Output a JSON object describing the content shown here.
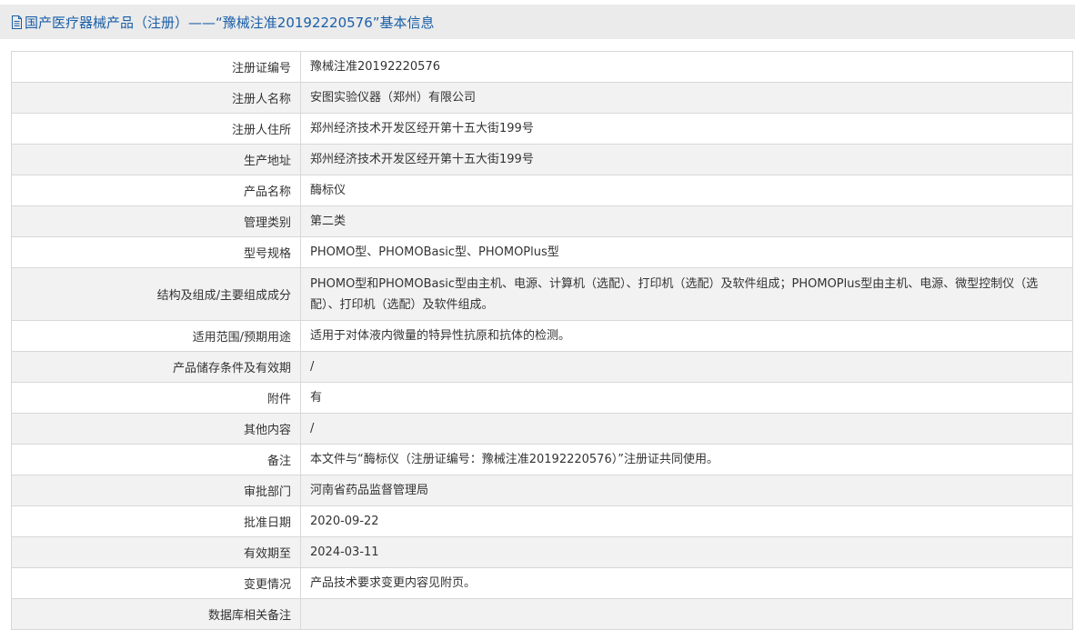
{
  "header": {
    "icon": "document-icon",
    "title": "国产医疗器械产品（注册）——“豫械注准20192220576”基本信息",
    "title_color": "#1a5fa8"
  },
  "rows": [
    {
      "label": "注册证编号",
      "value": "豫械注准20192220576"
    },
    {
      "label": "注册人名称",
      "value": "安图实验仪器（郑州）有限公司"
    },
    {
      "label": "注册人住所",
      "value": "郑州经济技术开发区经开第十五大街199号"
    },
    {
      "label": "生产地址",
      "value": "郑州经济技术开发区经开第十五大街199号"
    },
    {
      "label": "产品名称",
      "value": "酶标仪"
    },
    {
      "label": "管理类别",
      "value": "第二类"
    },
    {
      "label": "型号规格",
      "value": "PHOMO型、PHOMOBasic型、PHOMOPlus型"
    },
    {
      "label": "结构及组成/主要组成成分",
      "value": "PHOMO型和PHOMOBasic型由主机、电源、计算机（选配）、打印机（选配）及软件组成；PHOMOPlus型由主机、电源、微型控制仪（选配）、打印机（选配）及软件组成。"
    },
    {
      "label": "适用范围/预期用途",
      "value": "适用于对体液内微量的特异性抗原和抗体的检测。"
    },
    {
      "label": "产品储存条件及有效期",
      "value": "/"
    },
    {
      "label": "附件",
      "value": "有"
    },
    {
      "label": "其他内容",
      "value": "/"
    },
    {
      "label": "备注",
      "value": "本文件与“酶标仪（注册证编号：豫械注准20192220576）”注册证共同使用。"
    },
    {
      "label": "审批部门",
      "value": "河南省药品监督管理局"
    },
    {
      "label": "批准日期",
      "value": "2020-09-22"
    },
    {
      "label": "有效期至",
      "value": "2024-03-11"
    },
    {
      "label": "变更情况",
      "value": "产品技术要求变更内容见附页。"
    },
    {
      "label": "数据库相关备注",
      "value": ""
    }
  ]
}
